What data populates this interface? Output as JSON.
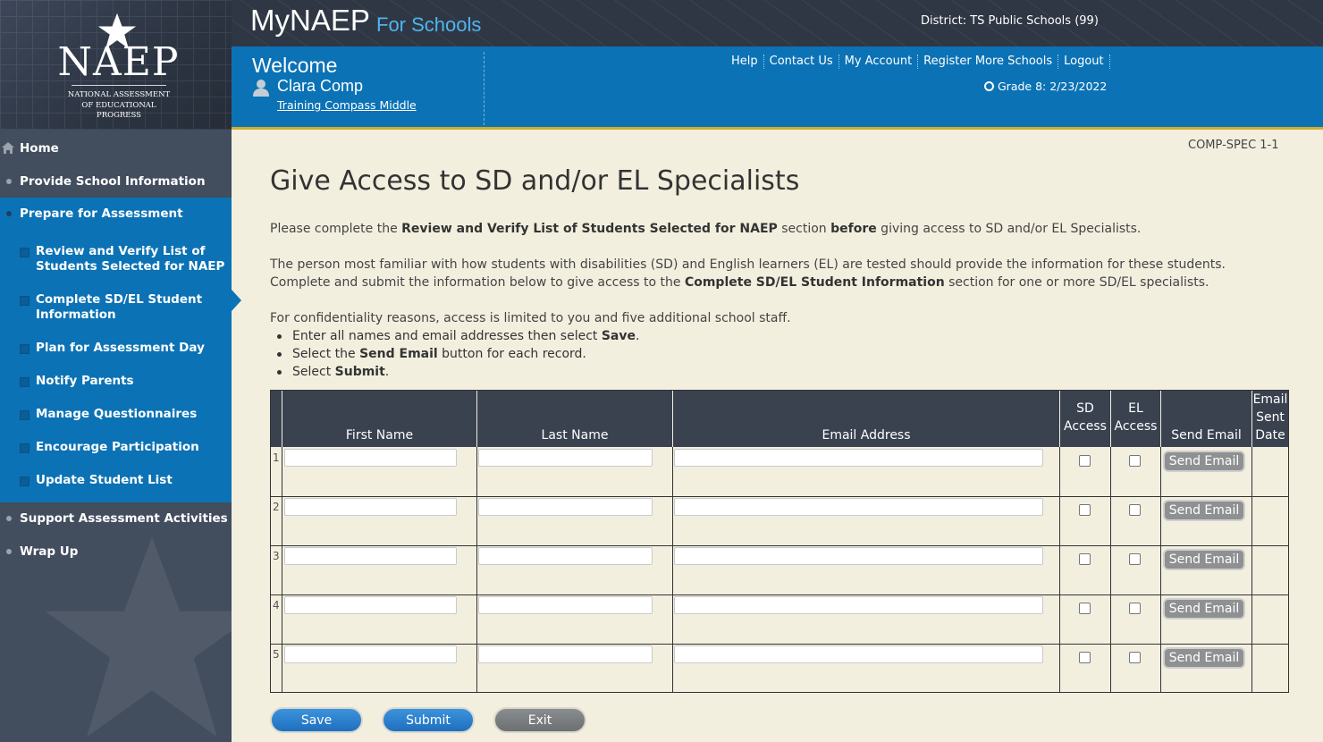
{
  "logo": {
    "wordmark": "NAEP",
    "subtitle_lines": [
      "NATIONAL ASSESSMENT",
      "OF EDUCATIONAL",
      "PROGRESS"
    ]
  },
  "header": {
    "app_title": "MyNAEP",
    "app_subtitle": "For Schools",
    "district": "District: TS Public Schools (99)",
    "welcome": "Welcome",
    "user_name": "Clara Comp",
    "school": "Training Compass Middle",
    "links": [
      "Help",
      "Contact Us",
      "My Account",
      "Register More Schools",
      "Logout"
    ],
    "grade": "Grade 8: 2/23/2022"
  },
  "sidebar": {
    "home": "Home",
    "provide_info": "Provide School Information",
    "prepare": "Prepare for Assessment",
    "sub_items": [
      "Review and Verify List of Students Selected for NAEP",
      "Complete SD/EL Student Information",
      "Plan for Assessment Day",
      "Notify Parents",
      "Manage Questionnaires",
      "Encourage Participation",
      "Update Student List"
    ],
    "support": "Support Assessment Activities",
    "wrap_up": "Wrap Up"
  },
  "main": {
    "page_code": "COMP-SPEC 1-1",
    "title": "Give Access to SD and/or EL Specialists",
    "p1": {
      "a": "Please complete the ",
      "b": "Review and Verify List of Students Selected for NAEP",
      "c": " section ",
      "d": "before",
      "e": " giving access to SD and/or EL Specialists."
    },
    "p2": {
      "line1": "The person most familiar with how students with disabilities (SD) and English learners (EL) are tested should provide the information for these students.",
      "a": "Complete and submit the information below to give access to the ",
      "b": "Complete SD/EL Student Information",
      "c": " section for one or more SD/EL specialists."
    },
    "p3": "For confidentiality reasons, access is limited to you and five additional school staff.",
    "bullets": {
      "b1a": "Enter all names and email addresses then select ",
      "b1b": "Save",
      "b1c": ".",
      "b2a": "Select the ",
      "b2b": "Send Email",
      "b2c": " button for each record.",
      "b3a": "Select ",
      "b3b": "Submit",
      "b3c": "."
    }
  },
  "table": {
    "headers": {
      "first_name": "First Name",
      "last_name": "Last Name",
      "email": "Email Address",
      "sd_1": "SD",
      "sd_2": "Access",
      "el_1": "EL",
      "el_2": "Access",
      "send_email": "Send Email",
      "sent_1": "Email",
      "sent_2": "Sent",
      "sent_3": "Date"
    },
    "rows": [
      {
        "num": "1",
        "first": "",
        "last": "",
        "email": "",
        "sd": false,
        "el": false,
        "button": "Send Email",
        "sent": ""
      },
      {
        "num": "2",
        "first": "",
        "last": "",
        "email": "",
        "sd": false,
        "el": false,
        "button": "Send Email",
        "sent": ""
      },
      {
        "num": "3",
        "first": "",
        "last": "",
        "email": "",
        "sd": false,
        "el": false,
        "button": "Send Email",
        "sent": ""
      },
      {
        "num": "4",
        "first": "",
        "last": "",
        "email": "",
        "sd": false,
        "el": false,
        "button": "Send Email",
        "sent": ""
      },
      {
        "num": "5",
        "first": "",
        "last": "",
        "email": "",
        "sd": false,
        "el": false,
        "button": "Send Email",
        "sent": ""
      }
    ]
  },
  "actions": {
    "save": "Save",
    "submit": "Submit",
    "exit": "Exit"
  },
  "colors": {
    "brand_blue": "#0b72b5",
    "header_dark": "#2f3744",
    "sidebar_dark": "#424d5e",
    "accent_gold": "#d3ab2a",
    "page_bg": "#f3efdf"
  }
}
